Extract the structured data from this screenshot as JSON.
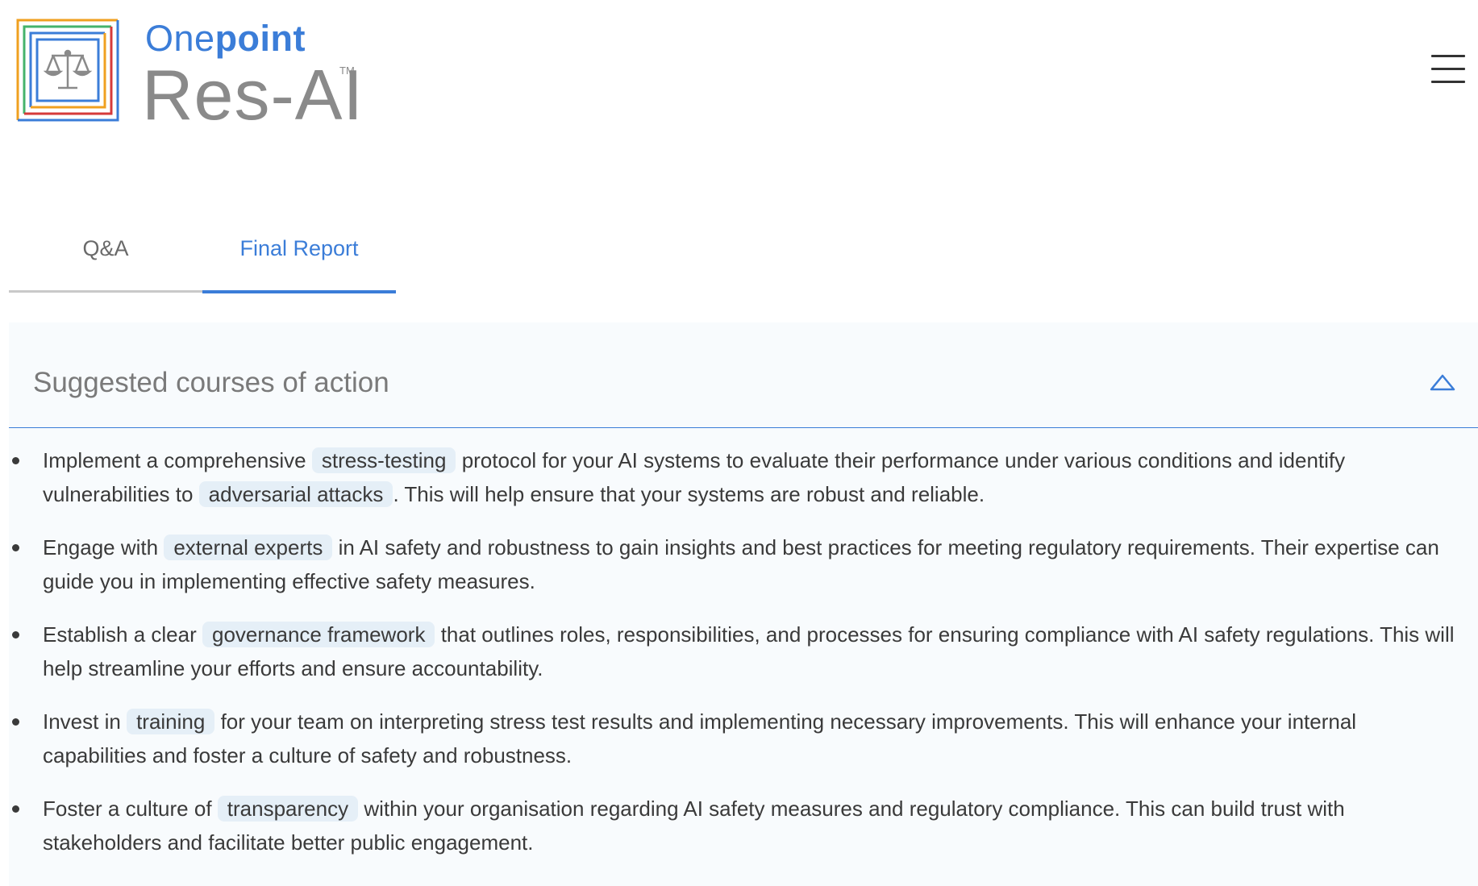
{
  "brand": {
    "top_light": "One",
    "top_bold": "point",
    "product": "Res-AI",
    "trademark": "TM"
  },
  "colors": {
    "accent": "#3b7dd8",
    "text": "#3a3a3a",
    "tag_bg": "#e5eff7",
    "logo_orange": "#f0a020",
    "logo_green": "#45b36b",
    "logo_red": "#d63a3a",
    "logo_blue": "#3b7dd8"
  },
  "tabs": [
    {
      "label": "Q&A",
      "active": false
    },
    {
      "label": "Final Report",
      "active": true
    }
  ],
  "section": {
    "title": "Suggested courses of action",
    "expanded": true,
    "items": [
      {
        "before": "Implement a comprehensive",
        "tag": "stress-testing",
        "middle": "protocol for your AI systems to evaluate their performance under various conditions and identify vulnerabilities to",
        "tag2": "adversarial attacks",
        "after": ". This will help ensure that your systems are robust and reliable."
      },
      {
        "before": "Engage with",
        "tag": "external experts",
        "middle": "in AI safety and robustness to gain insights and best practices for meeting regulatory requirements. Their expertise can guide you in implementing effective safety measures."
      },
      {
        "before": "Establish a clear",
        "tag": "governance framework",
        "middle": "that outlines roles, responsibilities, and processes for ensuring compliance with AI safety regulations. This will help streamline your efforts and ensure accountability."
      },
      {
        "before": "Invest in",
        "tag": "training",
        "middle": "for your team on interpreting stress test results and implementing necessary improvements. This will enhance your internal capabilities and foster a culture of safety and robustness."
      },
      {
        "before": "Foster a culture of",
        "tag": "transparency",
        "middle": "within your organisation regarding AI safety measures and regulatory compliance. This can build trust with stakeholders and facilitate better public engagement."
      }
    ]
  },
  "icons": {
    "logo": "scales-of-justice-icon",
    "menu": "hamburger-menu-icon",
    "collapse": "chevron-up-icon"
  }
}
